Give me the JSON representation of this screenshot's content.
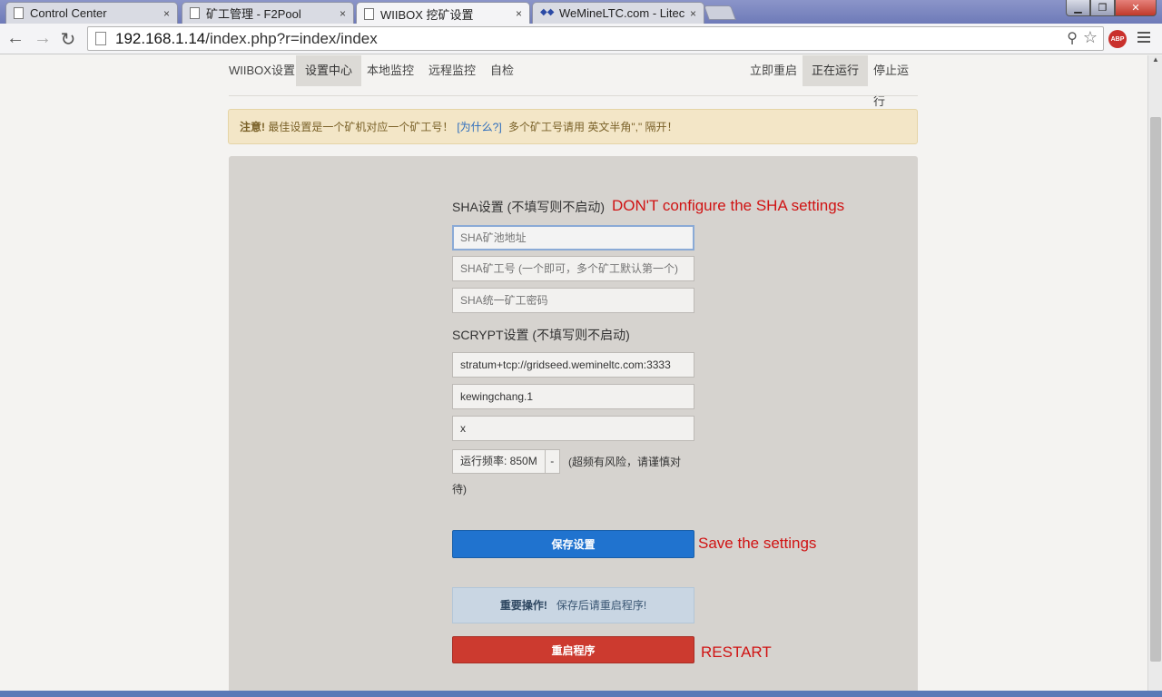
{
  "browser": {
    "tabs": [
      {
        "label": "Control Center",
        "close": "×"
      },
      {
        "label": "矿工管理 - F2Pool",
        "close": "×"
      },
      {
        "label": "WIIBOX 挖矿设置",
        "close": "×"
      },
      {
        "label": "WeMineLTC.com - Litec",
        "close": "×"
      }
    ],
    "url_host": "192.168.1.14",
    "url_path": "/index.php?r=index/index",
    "abp_label": "ABP",
    "icons": {
      "back": "back-arrow-icon",
      "forward": "forward-arrow-icon",
      "reload": "reload-icon",
      "zoom": "zoom-icon",
      "star": "bookmark-star-icon",
      "menu": "hamburger-menu-icon"
    }
  },
  "nav": {
    "left": [
      "WIIBOX设置",
      "设置中心",
      "本地监控",
      "远程监控",
      "自检"
    ],
    "right": [
      "立即重启",
      "正在运行",
      "停止运行"
    ],
    "active_left": "设置中心",
    "active_right": "正在运行"
  },
  "alert": {
    "strong": "注意!",
    "text1": " 最佳设置是一个矿机对应一个矿工号！",
    "link": "[为什么?]",
    "text2": " 多个矿工号请用 英文半角\",\" 隔开！"
  },
  "sha": {
    "label": "SHA设置 (不填写则不启动)",
    "annotation": "DON'T configure the SHA settings",
    "pool_placeholder": "SHA矿池地址",
    "worker_placeholder": "SHA矿工号 (一个即可，多个矿工默认第一个)",
    "password_placeholder": "SHA统一矿工密码"
  },
  "scrypt": {
    "label": "SCRYPT设置 (不填写则不启动)",
    "pool_value": "stratum+tcp://gridseed.wemineltc.com:3333",
    "worker_value": "kewingchang.1",
    "password_value": "x",
    "freq_label": "运行频率: 850M",
    "freq_caret": "-",
    "freq_note_line1": "(超频有风险，请谨慎对",
    "freq_note_line2": "待)"
  },
  "actions": {
    "save_label": "保存设置",
    "save_annotation": "Save the settings",
    "notice_strong": "重要操作!",
    "notice_text": "   保存后请重启程序!",
    "restart_label": "重启程序",
    "restart_annotation": "RESTART"
  },
  "colors": {
    "primary": "#2073cf",
    "danger": "#cc3a2f",
    "annotation": "#d01313",
    "alert_bg": "#f3e6c7"
  }
}
